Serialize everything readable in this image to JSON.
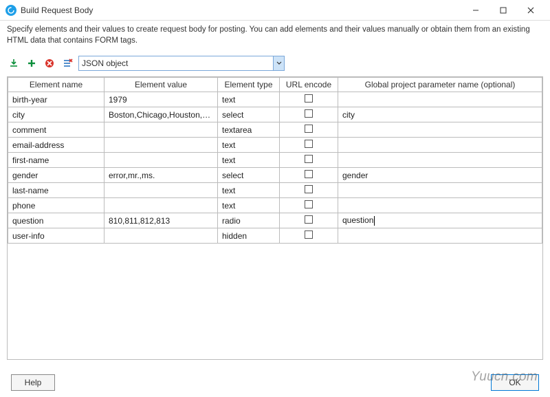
{
  "window": {
    "title": "Build Request Body",
    "icon": "rotate-arrows-icon"
  },
  "description": "Specify elements and their values to create request body for posting. You can add elements and their values manually or obtain them from an existing HTML data that contains FORM tags.",
  "toolbar": {
    "icons": [
      "import-icon",
      "add-icon",
      "remove-icon",
      "clear-icon"
    ],
    "format_selected": "JSON object"
  },
  "columns": [
    "Element name",
    "Element value",
    "Element type",
    "URL encode",
    "Global project parameter name (optional)"
  ],
  "rows": [
    {
      "name": "birth-year",
      "value": "1979",
      "type": "text",
      "url_encode": false,
      "global": ""
    },
    {
      "name": "city",
      "value": "Boston,Chicago,Houston,Los A...",
      "type": "select",
      "url_encode": false,
      "global": "city"
    },
    {
      "name": "comment",
      "value": "",
      "type": "textarea",
      "url_encode": false,
      "global": ""
    },
    {
      "name": "email-address",
      "value": "",
      "type": "text",
      "url_encode": false,
      "global": ""
    },
    {
      "name": "first-name",
      "value": "",
      "type": "text",
      "url_encode": false,
      "global": ""
    },
    {
      "name": "gender",
      "value": "error,mr.,ms.",
      "type": "select",
      "url_encode": false,
      "global": "gender"
    },
    {
      "name": "last-name",
      "value": "",
      "type": "text",
      "url_encode": false,
      "global": ""
    },
    {
      "name": "phone",
      "value": "",
      "type": "text",
      "url_encode": false,
      "global": ""
    },
    {
      "name": "question",
      "value": "810,811,812,813",
      "type": "radio",
      "url_encode": false,
      "global": "question",
      "editing": true
    },
    {
      "name": "user-info",
      "value": "",
      "type": "hidden",
      "url_encode": false,
      "global": ""
    }
  ],
  "footer": {
    "help": "Help",
    "ok": "OK"
  },
  "watermark": "Yuucn.com"
}
